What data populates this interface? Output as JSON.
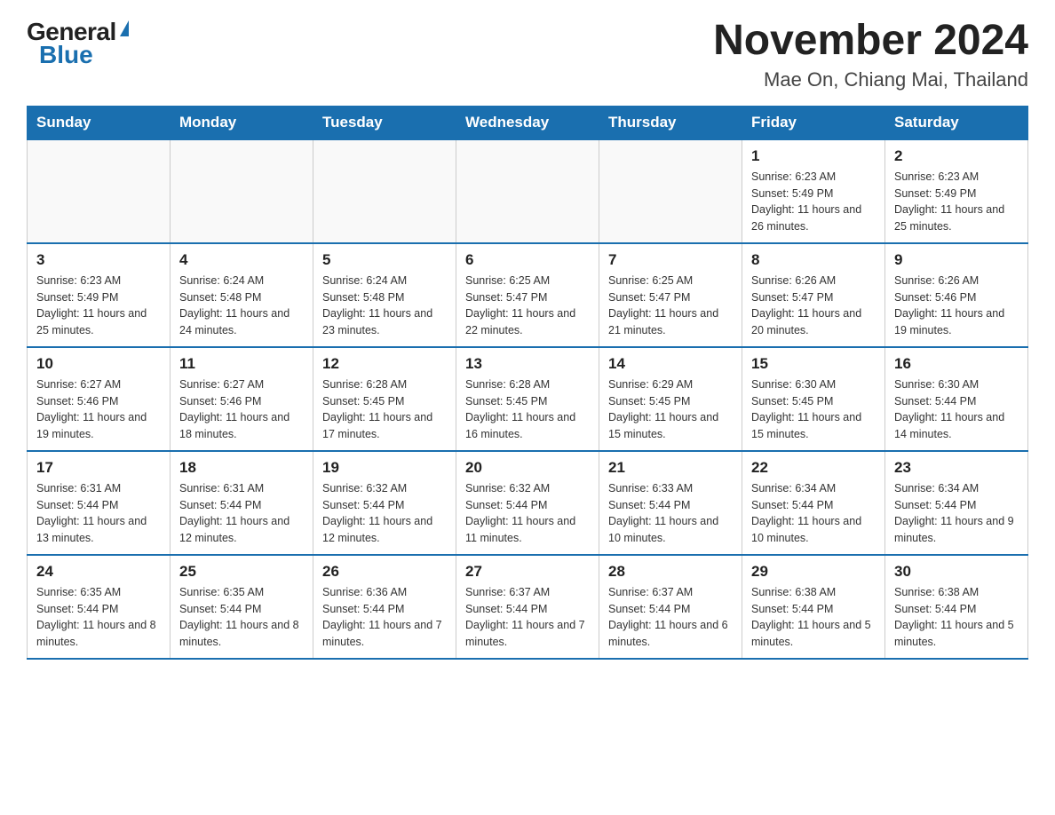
{
  "header": {
    "logo_general": "General",
    "logo_blue": "Blue",
    "month_year": "November 2024",
    "location": "Mae On, Chiang Mai, Thailand"
  },
  "calendar": {
    "days_of_week": [
      "Sunday",
      "Monday",
      "Tuesday",
      "Wednesday",
      "Thursday",
      "Friday",
      "Saturday"
    ],
    "weeks": [
      [
        {
          "day": "",
          "info": ""
        },
        {
          "day": "",
          "info": ""
        },
        {
          "day": "",
          "info": ""
        },
        {
          "day": "",
          "info": ""
        },
        {
          "day": "",
          "info": ""
        },
        {
          "day": "1",
          "info": "Sunrise: 6:23 AM\nSunset: 5:49 PM\nDaylight: 11 hours and 26 minutes."
        },
        {
          "day": "2",
          "info": "Sunrise: 6:23 AM\nSunset: 5:49 PM\nDaylight: 11 hours and 25 minutes."
        }
      ],
      [
        {
          "day": "3",
          "info": "Sunrise: 6:23 AM\nSunset: 5:49 PM\nDaylight: 11 hours and 25 minutes."
        },
        {
          "day": "4",
          "info": "Sunrise: 6:24 AM\nSunset: 5:48 PM\nDaylight: 11 hours and 24 minutes."
        },
        {
          "day": "5",
          "info": "Sunrise: 6:24 AM\nSunset: 5:48 PM\nDaylight: 11 hours and 23 minutes."
        },
        {
          "day": "6",
          "info": "Sunrise: 6:25 AM\nSunset: 5:47 PM\nDaylight: 11 hours and 22 minutes."
        },
        {
          "day": "7",
          "info": "Sunrise: 6:25 AM\nSunset: 5:47 PM\nDaylight: 11 hours and 21 minutes."
        },
        {
          "day": "8",
          "info": "Sunrise: 6:26 AM\nSunset: 5:47 PM\nDaylight: 11 hours and 20 minutes."
        },
        {
          "day": "9",
          "info": "Sunrise: 6:26 AM\nSunset: 5:46 PM\nDaylight: 11 hours and 19 minutes."
        }
      ],
      [
        {
          "day": "10",
          "info": "Sunrise: 6:27 AM\nSunset: 5:46 PM\nDaylight: 11 hours and 19 minutes."
        },
        {
          "day": "11",
          "info": "Sunrise: 6:27 AM\nSunset: 5:46 PM\nDaylight: 11 hours and 18 minutes."
        },
        {
          "day": "12",
          "info": "Sunrise: 6:28 AM\nSunset: 5:45 PM\nDaylight: 11 hours and 17 minutes."
        },
        {
          "day": "13",
          "info": "Sunrise: 6:28 AM\nSunset: 5:45 PM\nDaylight: 11 hours and 16 minutes."
        },
        {
          "day": "14",
          "info": "Sunrise: 6:29 AM\nSunset: 5:45 PM\nDaylight: 11 hours and 15 minutes."
        },
        {
          "day": "15",
          "info": "Sunrise: 6:30 AM\nSunset: 5:45 PM\nDaylight: 11 hours and 15 minutes."
        },
        {
          "day": "16",
          "info": "Sunrise: 6:30 AM\nSunset: 5:44 PM\nDaylight: 11 hours and 14 minutes."
        }
      ],
      [
        {
          "day": "17",
          "info": "Sunrise: 6:31 AM\nSunset: 5:44 PM\nDaylight: 11 hours and 13 minutes."
        },
        {
          "day": "18",
          "info": "Sunrise: 6:31 AM\nSunset: 5:44 PM\nDaylight: 11 hours and 12 minutes."
        },
        {
          "day": "19",
          "info": "Sunrise: 6:32 AM\nSunset: 5:44 PM\nDaylight: 11 hours and 12 minutes."
        },
        {
          "day": "20",
          "info": "Sunrise: 6:32 AM\nSunset: 5:44 PM\nDaylight: 11 hours and 11 minutes."
        },
        {
          "day": "21",
          "info": "Sunrise: 6:33 AM\nSunset: 5:44 PM\nDaylight: 11 hours and 10 minutes."
        },
        {
          "day": "22",
          "info": "Sunrise: 6:34 AM\nSunset: 5:44 PM\nDaylight: 11 hours and 10 minutes."
        },
        {
          "day": "23",
          "info": "Sunrise: 6:34 AM\nSunset: 5:44 PM\nDaylight: 11 hours and 9 minutes."
        }
      ],
      [
        {
          "day": "24",
          "info": "Sunrise: 6:35 AM\nSunset: 5:44 PM\nDaylight: 11 hours and 8 minutes."
        },
        {
          "day": "25",
          "info": "Sunrise: 6:35 AM\nSunset: 5:44 PM\nDaylight: 11 hours and 8 minutes."
        },
        {
          "day": "26",
          "info": "Sunrise: 6:36 AM\nSunset: 5:44 PM\nDaylight: 11 hours and 7 minutes."
        },
        {
          "day": "27",
          "info": "Sunrise: 6:37 AM\nSunset: 5:44 PM\nDaylight: 11 hours and 7 minutes."
        },
        {
          "day": "28",
          "info": "Sunrise: 6:37 AM\nSunset: 5:44 PM\nDaylight: 11 hours and 6 minutes."
        },
        {
          "day": "29",
          "info": "Sunrise: 6:38 AM\nSunset: 5:44 PM\nDaylight: 11 hours and 5 minutes."
        },
        {
          "day": "30",
          "info": "Sunrise: 6:38 AM\nSunset: 5:44 PM\nDaylight: 11 hours and 5 minutes."
        }
      ]
    ]
  }
}
